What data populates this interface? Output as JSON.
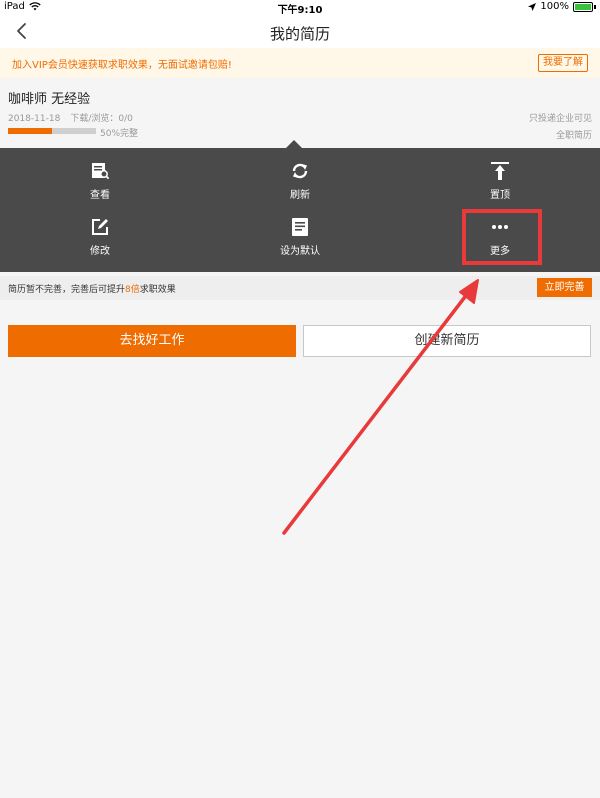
{
  "status_bar": {
    "device": "iPad",
    "time": "下午9:10",
    "battery": "100%",
    "wifi_icon": "wifi-icon",
    "location_icon": "location-arrow-icon",
    "battery_icon": "battery-icon"
  },
  "nav": {
    "title": "我的简历",
    "back_icon": "chevron-left-icon"
  },
  "vip_banner": {
    "text": "加入VIP会员快速获取求职效果，无面试邀请包赔!",
    "button": "我要了解"
  },
  "resume": {
    "title": "咖啡师 无经验",
    "date": "2018-11-18",
    "stats": "下载/浏览：0/0",
    "completion_text": "50%完整",
    "completion_fraction": 0.5,
    "visibility": "只投递企业可见",
    "type": "全职简历"
  },
  "actions": [
    {
      "label": "查看",
      "icon": "view-document-icon"
    },
    {
      "label": "刷新",
      "icon": "refresh-icon"
    },
    {
      "label": "置顶",
      "icon": "pin-top-icon"
    },
    {
      "label": "修改",
      "icon": "edit-icon"
    },
    {
      "label": "设为默认",
      "icon": "set-default-icon"
    },
    {
      "label": "更多",
      "icon": "more-dots-icon"
    }
  ],
  "complete_banner": {
    "text_before": "简历暂不完善，完善后可提升",
    "highlight": "8倍",
    "text_after": "求职效果",
    "button": "立即完善"
  },
  "buttons": {
    "find_job": "去找好工作",
    "create_resume": "创建新简历"
  },
  "colors": {
    "accent": "#ef6c00",
    "menu_bg": "#4a4a4a",
    "annotation_red": "#e83a3a",
    "banner_bg": "#fff8e8"
  }
}
